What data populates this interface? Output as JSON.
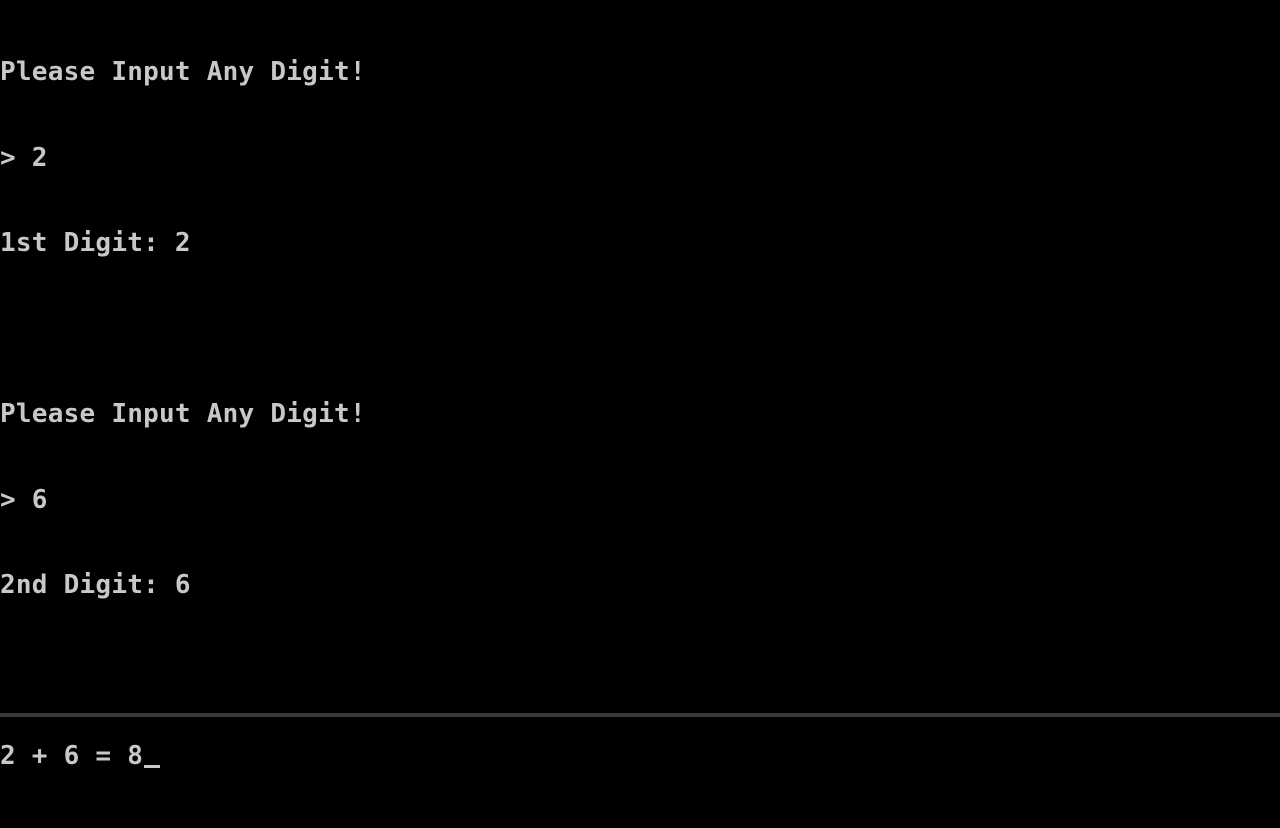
{
  "console": {
    "lines": [
      "Please Input Any Digit!",
      "> 2",
      "1st Digit: 2",
      "",
      "Please Input Any Digit!",
      "> 6",
      "2nd Digit: 6",
      "",
      "2 + 6 = 8"
    ],
    "cursor": "_",
    "text_color": "#c8c8c8",
    "background_color": "#000000"
  }
}
